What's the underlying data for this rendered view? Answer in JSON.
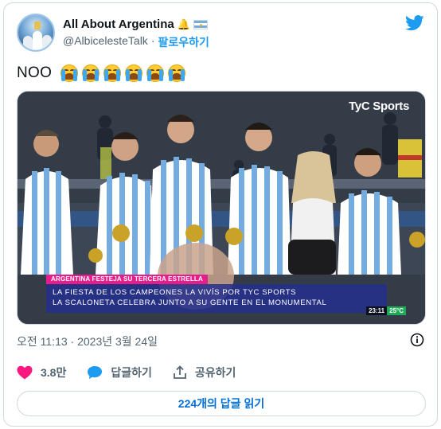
{
  "author": {
    "display_name": "All About Argentina",
    "handle": "@AlbicelesteTalk",
    "separator": "·",
    "follow_label": "팔로우하기",
    "badges": [
      "bell-emoji",
      "argentina-flag"
    ]
  },
  "tweet": {
    "text": "NOO",
    "emoji": [
      "loudly-crying-face",
      "loudly-crying-face",
      "loudly-crying-face",
      "loudly-crying-face",
      "loudly-crying-face",
      "loudly-crying-face"
    ]
  },
  "media": {
    "broadcaster_logo": "TyC Sports",
    "chyron_tag": "ARGENTINA FESTEJA SU TERCERA ESTRELLA",
    "chyron_line1": "LA FIESTA DE LOS CAMPEONES LA VIVÍS POR TYC SPORTS",
    "chyron_line2": "LA SCALONETA CELEBRA JUNTO A SU GENTE EN EL MONUMENTAL",
    "clock": "23:11",
    "temperature": "25°C"
  },
  "timestamp": "오전 11:13 · 2023년 3월 24일",
  "actions": {
    "likes_count": "3.8만",
    "reply_label": "답글하기",
    "share_label": "공유하기"
  },
  "read_replies_label": "224개의 답글 읽기",
  "colors": {
    "twitter_blue": "#1d9bf0",
    "like_pink": "#f91880",
    "text_secondary": "#536471",
    "chyron_magenta": "#e61e8c",
    "chyron_blue": "#26308c"
  }
}
